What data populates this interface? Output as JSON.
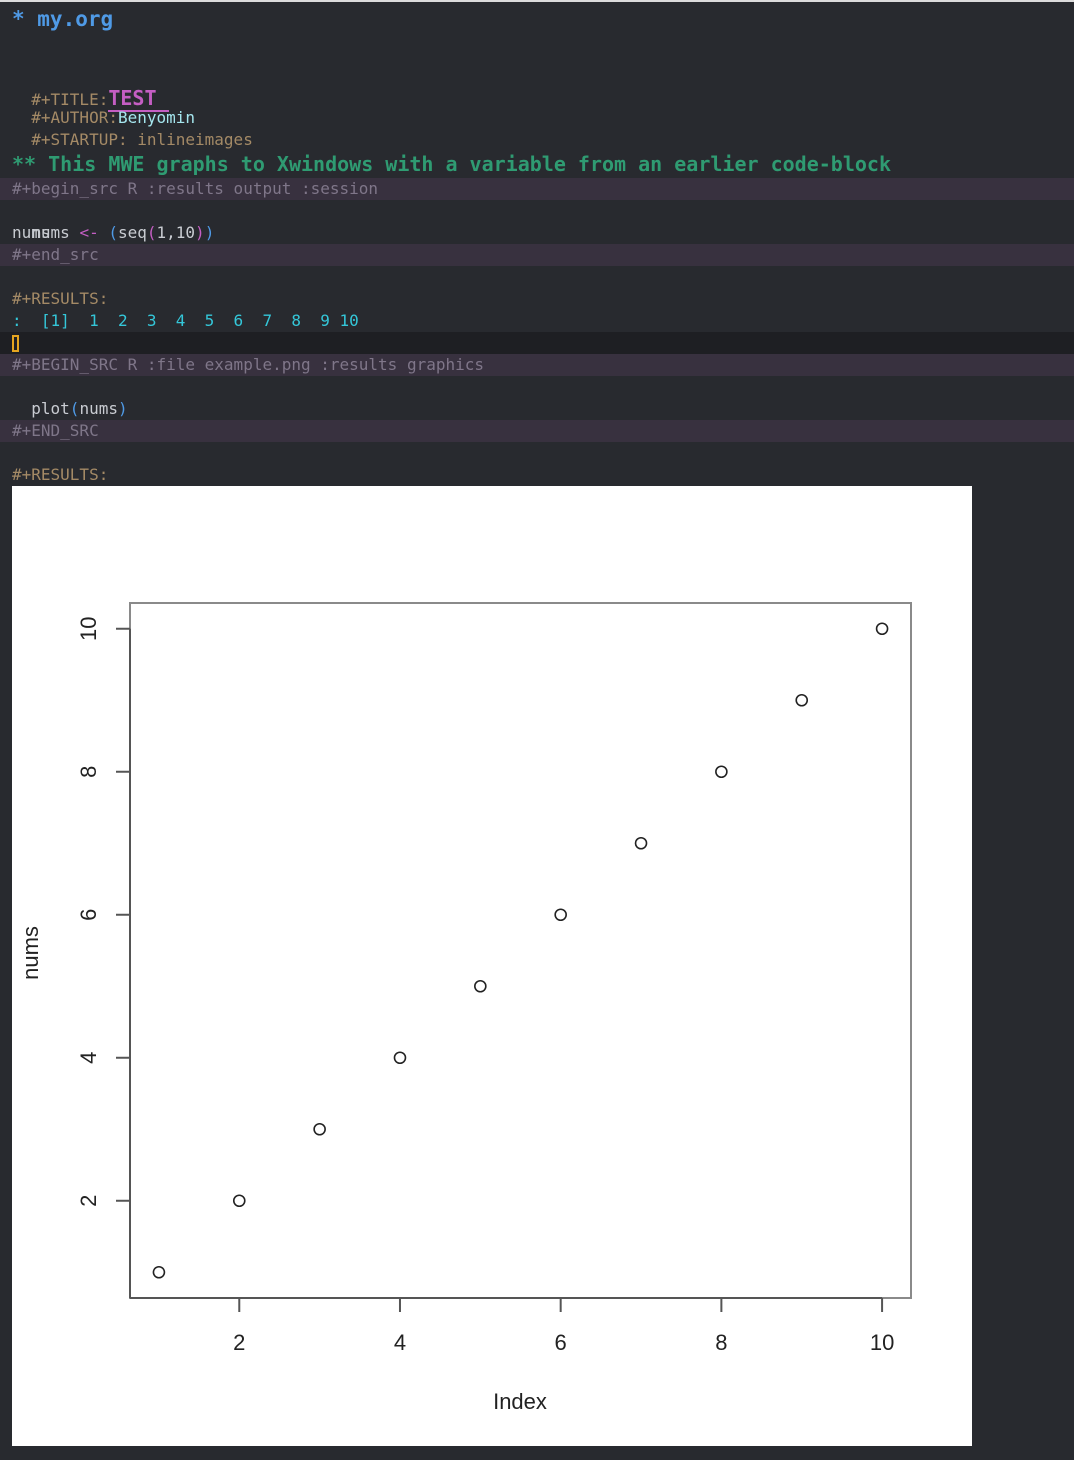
{
  "buffer": {
    "heading1": "* my.org",
    "keywords": {
      "title_key": "#+TITLE:",
      "title_value": "TEST",
      "author_key": "#+AUTHOR:",
      "author_value": "Benyomin",
      "startup_key": "#+STARTUP:",
      "startup_value": " inlineimages"
    },
    "heading2": "** This MWE graphs to Xwindows with a variable from an earlier code-block",
    "block1": {
      "begin": "#+begin_src R :results output :session",
      "code_line1": {
        "var": "nums ",
        "arrow": "<-",
        "open_outer": " (",
        "fn": "seq",
        "open_inner": "(",
        "args": "1,10",
        "close_inner": ")",
        "close_outer": ")"
      },
      "code_line2": "nums",
      "end": "#+end_src"
    },
    "results1": {
      "label": "#+RESULTS:",
      "value": ":  [1]  1  2  3  4  5  6  7  8  9 10"
    },
    "block2": {
      "begin": "#+BEGIN_SRC R :file example.png :results graphics",
      "code_fn": "plot",
      "code_open": "(",
      "code_arg": "nums",
      "code_close": ")",
      "end": "#+END_SRC"
    },
    "results2": {
      "label": "#+RESULTS:"
    }
  },
  "colors": {
    "background": "#282a2f",
    "heading1": "#4f9ae6",
    "heading2": "#2f9b72",
    "keyword": "#a48a66",
    "title": "#c45ec3",
    "result": "#34c7d9",
    "cursor": "#e5a520",
    "src_block_bg": "#38313f"
  },
  "chart_data": {
    "type": "scatter",
    "title": "",
    "xlabel": "Index",
    "ylabel": "nums",
    "x": [
      1,
      2,
      3,
      4,
      5,
      6,
      7,
      8,
      9,
      10
    ],
    "y": [
      1,
      2,
      3,
      4,
      5,
      6,
      7,
      8,
      9,
      10
    ],
    "xlim": [
      0.64,
      10.36
    ],
    "ylim": [
      0.64,
      10.36
    ],
    "xticks": [
      2,
      4,
      6,
      8,
      10
    ],
    "yticks": [
      2,
      4,
      6,
      8,
      10
    ],
    "xtick_labels": [
      "2",
      "4",
      "6",
      "8",
      "10"
    ],
    "ytick_labels": [
      "2",
      "4",
      "6",
      "8",
      "10"
    ],
    "marker": "open-circle",
    "grid": false,
    "legend": "none"
  }
}
